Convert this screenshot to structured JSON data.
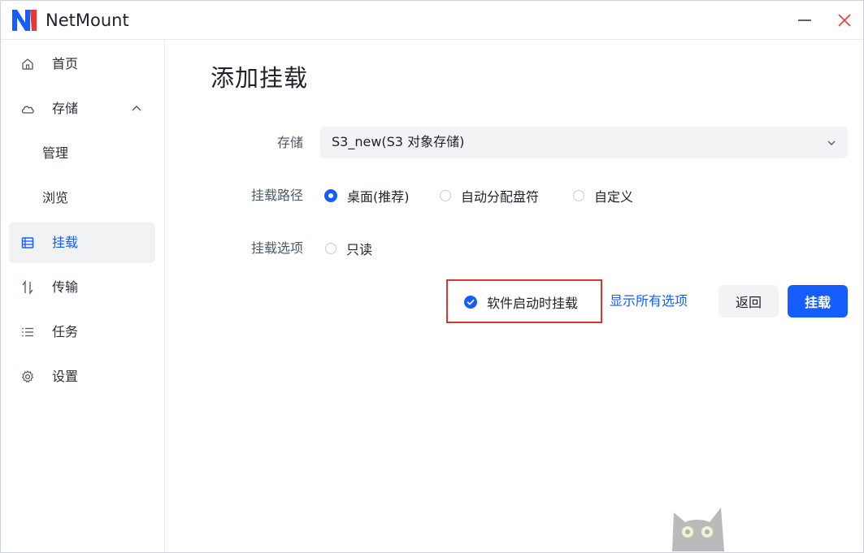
{
  "app": {
    "title": "NetMount",
    "logo_letter": "N",
    "brand_color": "#165dff"
  },
  "window_controls": {
    "minimize_icon": "minimize-icon",
    "close_icon": "close-icon"
  },
  "sidebar": {
    "items": [
      {
        "label": "首页",
        "icon": "home-icon"
      },
      {
        "label": "存储",
        "icon": "cloud-icon",
        "expanded": true
      },
      {
        "label": "管理",
        "sub": true
      },
      {
        "label": "浏览",
        "sub": true
      },
      {
        "label": "挂载",
        "icon": "list-icon",
        "active": true
      },
      {
        "label": "传输",
        "icon": "transfer-icon"
      },
      {
        "label": "任务",
        "icon": "tasks-icon"
      },
      {
        "label": "设置",
        "icon": "gear-icon"
      }
    ]
  },
  "main": {
    "title": "添加挂载",
    "storage": {
      "label": "存储",
      "selected": "S3_new(S3 对象存储)"
    },
    "mount_path": {
      "label": "挂载路径",
      "options": [
        "桌面(推荐)",
        "自动分配盘符",
        "自定义"
      ],
      "selected_index": 0
    },
    "mount_options": {
      "label": "挂载选项",
      "options": [
        "只读"
      ],
      "read_only_checked": false
    },
    "mount_on_startup": {
      "label": "软件启动时挂载",
      "checked": true
    },
    "show_all_options": "显示所有选项",
    "back_button": "返回",
    "mount_button": "挂载"
  }
}
